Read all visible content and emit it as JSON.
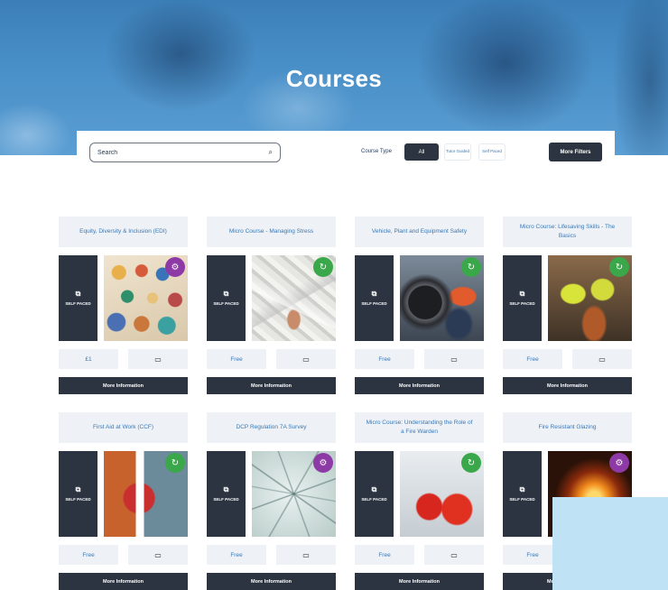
{
  "hero": {
    "title": "Courses"
  },
  "filters": {
    "search_placeholder": "Search",
    "course_type_label": "Course Type",
    "options": [
      {
        "label": "All",
        "selected": true
      },
      {
        "label": "Tutor Guided",
        "selected": false
      },
      {
        "label": "Self Paced",
        "selected": false
      }
    ],
    "more_filters_label": "More Filters"
  },
  "colors": {
    "accent_blue": "#3a78b5",
    "dark_button": "#2b3440",
    "badge_purple": "#8e3aa6",
    "badge_green": "#3aa84a",
    "card_bg": "#eef2f6"
  },
  "courses": [
    {
      "title": "Equity, Diversity & Inclusion (EDI)",
      "format": "SELF PACED",
      "price": "£1",
      "badge": "purple",
      "more_label": "More Information"
    },
    {
      "title": "Micro Course - Managing Stress",
      "format": "SELF PACED",
      "price": "Free",
      "badge": "green",
      "more_label": "More Information"
    },
    {
      "title": "Vehicle, Plant and Equipment Safety",
      "format": "SELF PACED",
      "price": "Free",
      "badge": "green",
      "more_label": "More Information"
    },
    {
      "title": "Micro Course: Lifesaving Skills - The Basics",
      "format": "SELF PACED",
      "price": "Free",
      "badge": "green",
      "more_label": "More Information"
    },
    {
      "title": "First Aid at Work (CCF)",
      "format": "SELF PACED",
      "price": "Free",
      "badge": "green",
      "more_label": "More Information"
    },
    {
      "title": "DCP Regulation 7A Survey",
      "format": "SELF PACED",
      "price": "Free",
      "badge": "purple",
      "more_label": "More Information"
    },
    {
      "title": "Micro Course: Understanding the Role of a Fire Warden",
      "format": "SELF PACED",
      "price": "Free",
      "badge": "green",
      "more_label": "More Information"
    },
    {
      "title": "Fire Resistant Glazing",
      "format": "SELF PACED",
      "price": "Free",
      "badge": "purple",
      "more_label": "More Information"
    }
  ]
}
